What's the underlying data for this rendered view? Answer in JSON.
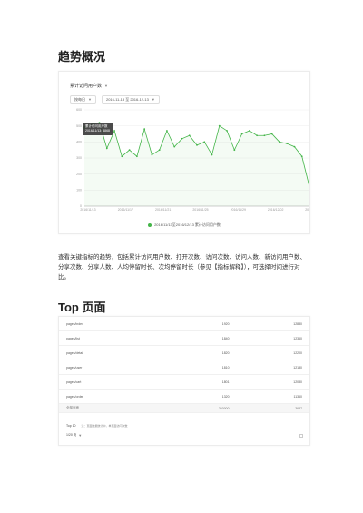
{
  "section1_title": "趋势概况",
  "trend": {
    "metric_label": "累计访问用户数",
    "granularity": "按每日",
    "date_range": "2016-11-13 至 2016-12-13",
    "tooltip_line1": "累计访问用户数",
    "tooltip_line2": "2016/11/13: 4868",
    "legend": "2016/11/13至2016/12/13 累计访问用户数",
    "accent_color": "#44b549"
  },
  "chart_data": {
    "type": "line",
    "x_tick_labels": [
      "2016/11/13",
      "2016/11/17",
      "2016/11/21",
      "2016/11/25",
      "2016/11/29",
      "2016/12/02",
      "2016/12/06"
    ],
    "y_tick_labels": [
      "0",
      "100",
      "200",
      "300",
      "400",
      "500",
      "600"
    ],
    "ylim": [
      0,
      600
    ],
    "grid": true,
    "legend_position": "bottom",
    "series": [
      {
        "name": "2016/11/13至2016/12/13 累计访问用户数",
        "x": [
          "2016/11/13",
          "2016/11/14",
          "2016/11/15",
          "2016/11/16",
          "2016/11/17",
          "2016/11/18",
          "2016/11/19",
          "2016/11/20",
          "2016/11/21",
          "2016/11/22",
          "2016/11/23",
          "2016/11/24",
          "2016/11/25",
          "2016/11/26",
          "2016/11/27",
          "2016/11/28",
          "2016/11/29",
          "2016/11/30",
          "2016/12/01",
          "2016/12/02",
          "2016/12/03",
          "2016/12/04",
          "2016/12/05",
          "2016/12/06",
          "2016/12/07",
          "2016/12/08",
          "2016/12/09",
          "2016/12/10",
          "2016/12/11",
          "2016/12/12",
          "2016/12/13"
        ],
        "values": [
          490,
          510,
          520,
          360,
          470,
          310,
          350,
          310,
          480,
          320,
          350,
          470,
          370,
          420,
          440,
          380,
          400,
          320,
          500,
          470,
          350,
          450,
          470,
          440,
          440,
          450,
          400,
          390,
          370,
          310,
          120
        ]
      }
    ]
  },
  "description": "查看关键指标的趋势，包括累计访问用户数、打开次数、访问次数、访问人数、新访问用户数、分享次数、分享人数、人均停留时长、次均停留时长（参见【指标解释】），可选择时间进行对比。",
  "section2_title": "Top 页面",
  "top_pages": {
    "rows": [
      {
        "name": "pages/index",
        "c1": "1920",
        "c2": "12880"
      },
      {
        "name": "pages/list",
        "c1": "1840",
        "c2": "12360"
      },
      {
        "name": "pages/detail",
        "c1": "1820",
        "c2": "12200"
      },
      {
        "name": "pages/user",
        "c1": "1810",
        "c2": "12130"
      },
      {
        "name": "pages/cart",
        "c1": "1801",
        "c2": "12080"
      },
      {
        "name": "pages/order",
        "c1": "1320",
        "c2": "11360"
      }
    ],
    "total_label": "全部页面",
    "total_c1": "360000",
    "total_c2": "3637",
    "footer_label": "Top 10",
    "footer_note": "注：页面数据统计中，单页面访问次数",
    "pager": "1/20 页"
  }
}
